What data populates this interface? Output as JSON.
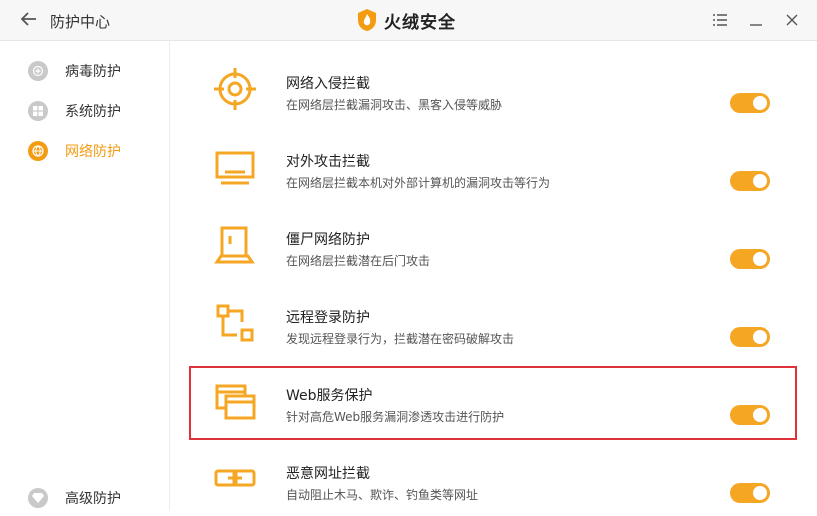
{
  "header": {
    "back_icon": "arrow-left-icon",
    "title": "防护中心",
    "brand_name": "火绒安全",
    "brand_logo": "shield-flame-logo",
    "controls": [
      "menu-icon",
      "minimize-icon",
      "close-icon"
    ]
  },
  "sidebar": {
    "items": [
      {
        "label": "病毒防护",
        "icon": "plus-circle-icon",
        "active": false
      },
      {
        "label": "系统防护",
        "icon": "windows-icon",
        "active": false
      },
      {
        "label": "网络防护",
        "icon": "globe-icon",
        "active": true
      },
      {
        "label": "高级防护",
        "icon": "diamond-icon",
        "active": false
      }
    ]
  },
  "features": [
    {
      "name": "网络入侵拦截",
      "desc": "在网络层拦截漏洞攻击、黑客入侵等威胁",
      "icon": "target-icon",
      "enabled": true
    },
    {
      "name": "对外攻击拦截",
      "desc": "在网络层拦截本机对外部计算机的漏洞攻击等行为",
      "icon": "monitor-icon",
      "enabled": true
    },
    {
      "name": "僵尸网络防护",
      "desc": "在网络层拦截潜在后门攻击",
      "icon": "laptop-icon",
      "enabled": true
    },
    {
      "name": "远程登录防护",
      "desc": "发现远程登录行为，拦截潜在密码破解攻击",
      "icon": "remote-nodes-icon",
      "enabled": true
    },
    {
      "name": "Web服务保护",
      "desc": "针对高危Web服务漏洞渗透攻击进行防护",
      "icon": "windows-stack-icon",
      "enabled": true
    },
    {
      "name": "恶意网址拦截",
      "desc": "自动阻止木马、欺诈、钓鱼类等网址",
      "icon": "link-icon",
      "enabled": true
    }
  ],
  "colors": {
    "accent": "#f5a623",
    "highlight_border": "#e0323a"
  }
}
